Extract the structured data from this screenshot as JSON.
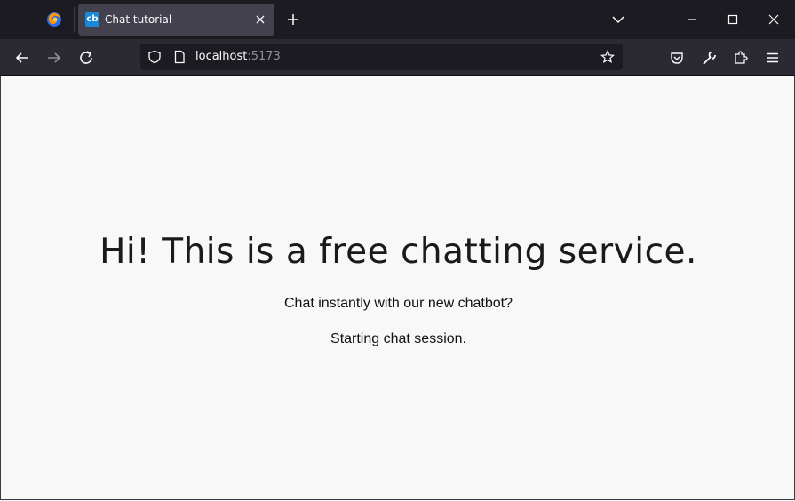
{
  "browser": {
    "tab": {
      "title": "Chat tutorial",
      "favicon_text": "cb"
    },
    "url": {
      "host": "localhost",
      "port": ":5173"
    }
  },
  "page": {
    "heading": "Hi! This is a free chatting service.",
    "subtitle": "Chat instantly with our new chatbot?",
    "status": "Starting chat session."
  },
  "colors": {
    "tabbar": "#1c1b22",
    "navbar": "#2b2a33",
    "active_tab": "#42414d",
    "page_bg": "#f8f8f8",
    "favicon": "#1a8ad8"
  }
}
